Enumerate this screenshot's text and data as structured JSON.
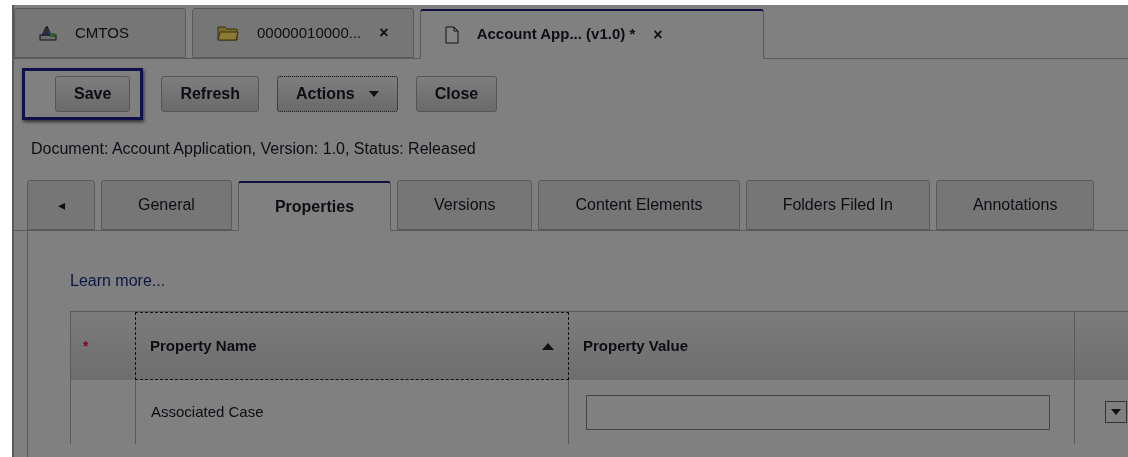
{
  "app_tabs": [
    {
      "label": "CMTOS",
      "kind": "ship",
      "closable": false,
      "selected": false
    },
    {
      "label": "00000010000...",
      "kind": "folder",
      "closable": true,
      "selected": false
    },
    {
      "label": "Account App... (v1.0) *",
      "kind": "document",
      "closable": true,
      "selected": true
    }
  ],
  "close_glyph": "×",
  "toolbar": [
    {
      "label": "Save",
      "kind": "button",
      "highlighted": true,
      "focused": false
    },
    {
      "label": "Refresh",
      "kind": "button",
      "highlighted": false,
      "focused": false
    },
    {
      "label": "Actions",
      "kind": "menu",
      "highlighted": false,
      "focused": true
    },
    {
      "label": "Close",
      "kind": "button",
      "highlighted": false,
      "focused": false
    }
  ],
  "document_info": "Document: Account Application, Version: 1.0, Status: Released",
  "tabs_scroll_glyph": "◂",
  "tabs": [
    {
      "label": "General",
      "selected": false
    },
    {
      "label": "Properties",
      "selected": true
    },
    {
      "label": "Versions",
      "selected": false
    },
    {
      "label": "Content Elements",
      "selected": false
    },
    {
      "label": "Folders Filed In",
      "selected": false
    },
    {
      "label": "Annotations",
      "selected": false
    }
  ],
  "learn_more": "Learn more...",
  "table": {
    "columns": [
      {
        "label": "*",
        "kind": "required"
      },
      {
        "label": "Property Name",
        "kind": "sorted"
      },
      {
        "label": "Property Value",
        "kind": "plain"
      }
    ],
    "rows": [
      {
        "name": "Associated Case",
        "kind": "field_with_menu"
      }
    ]
  }
}
